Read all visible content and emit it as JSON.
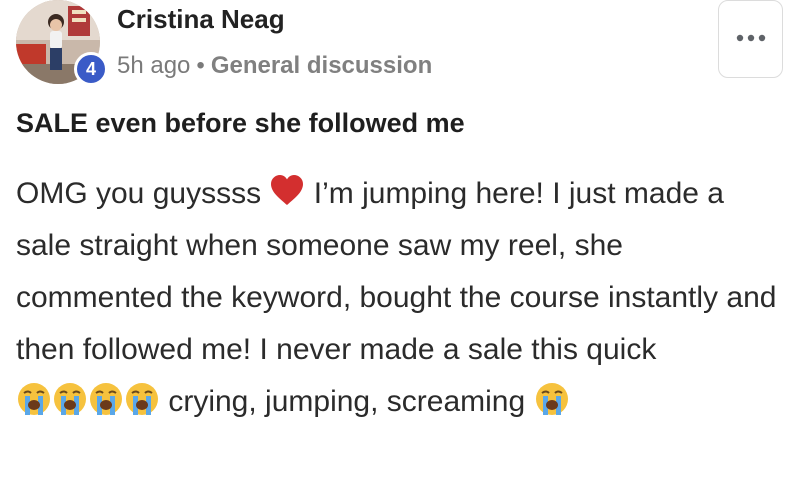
{
  "author": {
    "name": "Cristina Neag",
    "level": "4"
  },
  "meta": {
    "time": "5h ago",
    "separator": "•",
    "category": "General discussion"
  },
  "menu": {
    "icon": "more-horizontal-icon"
  },
  "post": {
    "title": "SALE even before she followed me",
    "body_part1": "OMG you guyssss",
    "body_part2": "I’m jumping here! I just made a sale straight when someone saw my reel, she commented the keyword, bought the course instantly and then followed me! I never made a sale this quick",
    "body_part3": "crying, jumping, screaming"
  },
  "emojis": {
    "heart": "red-heart-emoji",
    "crying": "loudly-crying-face-emoji"
  },
  "colors": {
    "badge": "#3a5bc7",
    "heart": "#d32f2f",
    "meta_text": "#7a7a7a"
  }
}
